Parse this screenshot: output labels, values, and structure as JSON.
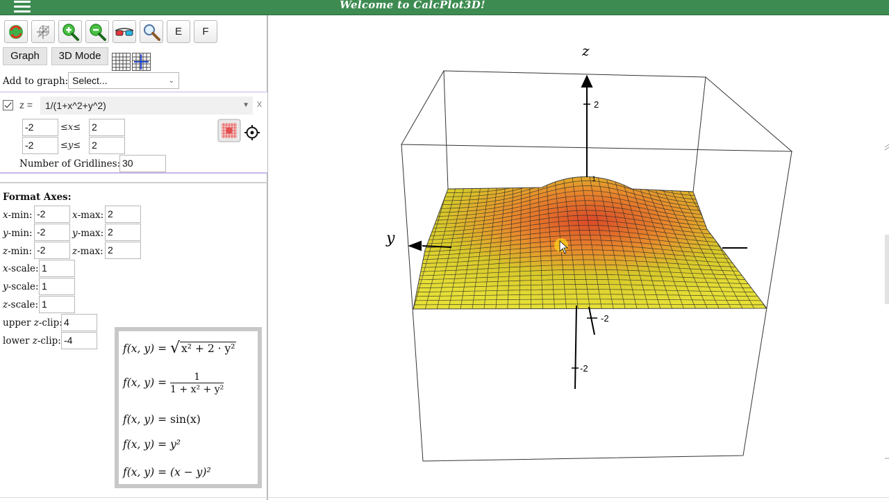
{
  "app": {
    "title": "Welcome to CalcPlot3D!"
  },
  "toolbar": {
    "buttons": [
      {
        "name": "reset-view-icon"
      },
      {
        "name": "rotate-mode-icon"
      },
      {
        "name": "zoom-in-icon"
      },
      {
        "name": "zoom-out-icon"
      },
      {
        "name": "3d-glasses-icon"
      },
      {
        "name": "magnifier-icon"
      },
      {
        "name": "e-button",
        "label": "E"
      },
      {
        "name": "f-button",
        "label": "F"
      }
    ]
  },
  "modes": {
    "graph": "Graph",
    "mode3d": "3D Mode"
  },
  "add_to_graph": {
    "label": "Add to graph:",
    "value": "Select..."
  },
  "function": {
    "checked": true,
    "prefix": "z =",
    "expression": "1/(1+x^2+y^2)",
    "remove": "x",
    "x_min": "-2",
    "x_max": "2",
    "x_relation": "≤",
    "x_var": "x",
    "y_min": "-2",
    "y_max": "2",
    "y_relation": "≤",
    "y_var": "y",
    "gridlines_label": "Number of Gridlines:",
    "gridlines": "30"
  },
  "format_axes": {
    "title": "Format Axes:",
    "x_min_label": "-min:",
    "x_min": "-2",
    "x_max_label": "-max:",
    "x_max": "2",
    "y_min": "-2",
    "y_max": "2",
    "z_min": "-2",
    "z_max": "2",
    "scale_label": "-scale:",
    "x_scale": "1",
    "y_scale": "1",
    "z_scale": "1",
    "upper_clip_label": "upper",
    "upper_clip_suffix": "-clip:",
    "upper_clip": "4",
    "lower_clip_label": "lower",
    "lower_clip": "-4"
  },
  "examples": {
    "lhs": "f(x, y) =",
    "e1_rad": "x² + 2 · y²",
    "e2_num": "1",
    "e2_den": "1 + x² + y²",
    "e3": "sin(x)",
    "e4": "y²",
    "e5": "(x − y)²"
  },
  "plot": {
    "axis_z": "z",
    "axis_y": "y",
    "tick_z_top": "2",
    "tick_y_right": "-2",
    "tick_z_bottom": "-2",
    "tick_x_small": "1",
    "colors": {
      "surface_low": "#e8e231",
      "surface_high": "#d9452a",
      "mesh": "#2a2a2a",
      "box": "#333333"
    }
  }
}
